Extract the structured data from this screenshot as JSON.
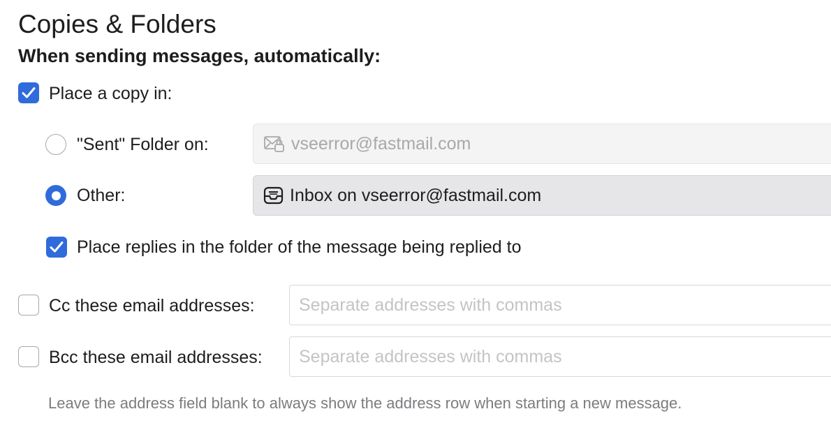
{
  "page": {
    "title": "Copies & Folders",
    "subtitle": "When sending messages, automatically:"
  },
  "place_copy": {
    "label": "Place a copy in:",
    "checked": true
  },
  "sent_folder": {
    "label": "\"Sent\" Folder on:",
    "selected": false,
    "popup_value": "vseerror@fastmail.com",
    "popup_icon": "mail-lock-icon",
    "enabled": false
  },
  "other_folder": {
    "label": "Other:",
    "selected": true,
    "popup_value": "Inbox on vseerror@fastmail.com",
    "popup_icon": "inbox-tray-icon"
  },
  "place_replies": {
    "label": "Place replies in the folder of the message being replied to",
    "checked": true
  },
  "cc": {
    "label": "Cc these email addresses:",
    "checked": false,
    "value": "",
    "placeholder": "Separate addresses with commas"
  },
  "bcc": {
    "label": "Bcc these email addresses:",
    "checked": false,
    "value": "",
    "placeholder": "Separate addresses with commas"
  },
  "hint": "Leave the address field blank to always show the address row when starting a new message.",
  "colors": {
    "accent": "#2f6bdb",
    "text": "#1d1d1f",
    "secondary_text": "#7c7c80",
    "placeholder": "#c4c4c8"
  }
}
